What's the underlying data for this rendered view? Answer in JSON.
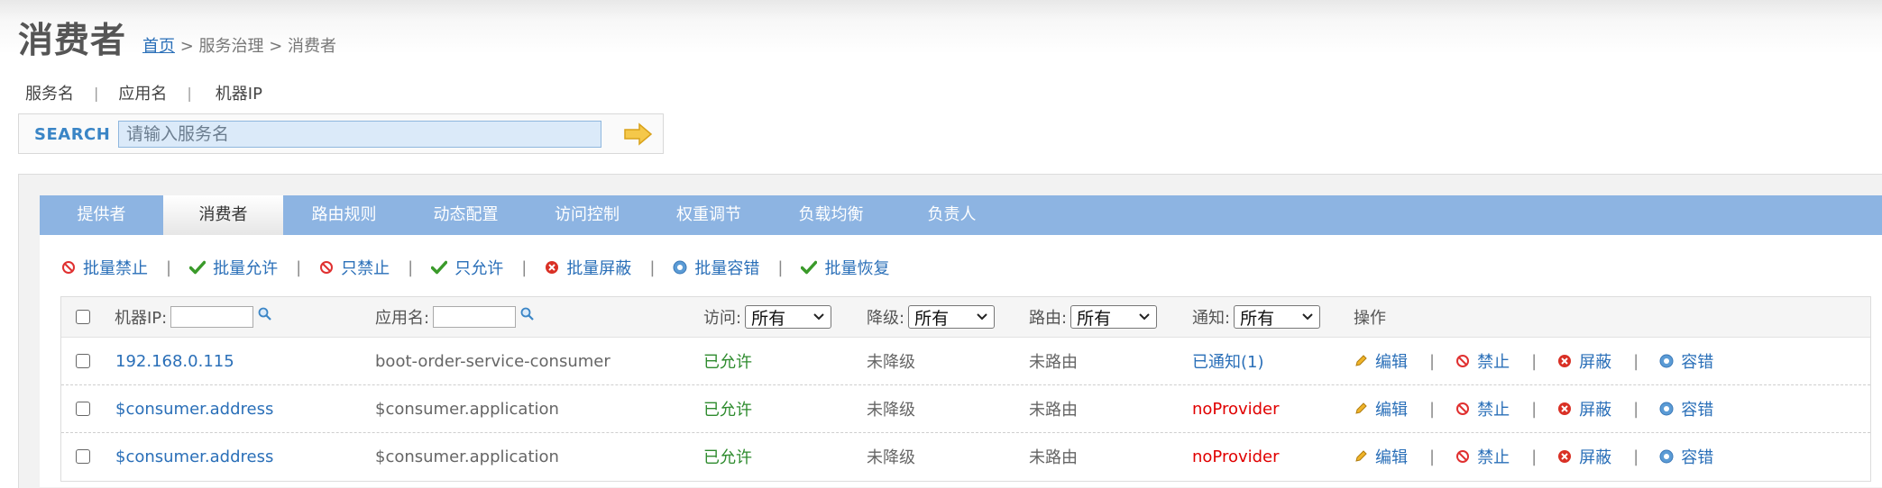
{
  "page": {
    "title": "消费者"
  },
  "breadcrumb": {
    "home": "首页",
    "rest": " > 服务治理 > 消费者"
  },
  "search_tabs": [
    {
      "label": "服务名",
      "active": true
    },
    {
      "label": "应用名",
      "active": false
    },
    {
      "label": "机器IP",
      "active": false
    }
  ],
  "search": {
    "label": "SEARCH",
    "placeholder": "请输入服务名",
    "value": ""
  },
  "tabs": [
    {
      "label": "提供者",
      "active": false
    },
    {
      "label": "消费者",
      "active": true
    },
    {
      "label": "路由规则",
      "active": false
    },
    {
      "label": "动态配置",
      "active": false
    },
    {
      "label": "访问控制",
      "active": false
    },
    {
      "label": "权重调节",
      "active": false
    },
    {
      "label": "负载均衡",
      "active": false
    },
    {
      "label": "负责人",
      "active": false
    }
  ],
  "batch_actions": [
    {
      "label": "批量禁止",
      "icon": "forbid-icon"
    },
    {
      "label": "批量允许",
      "icon": "check-icon"
    },
    {
      "label": "只禁止",
      "icon": "forbid-icon"
    },
    {
      "label": "只允许",
      "icon": "check-icon"
    },
    {
      "label": "批量屏蔽",
      "icon": "shield-x-icon"
    },
    {
      "label": "批量容错",
      "icon": "gear-icon"
    },
    {
      "label": "批量恢复",
      "icon": "check-icon"
    }
  ],
  "table": {
    "headers": {
      "ip": "机器IP:",
      "app": "应用名:",
      "access": "访问:",
      "degrade": "降级:",
      "route": "路由:",
      "notify": "通知:",
      "ops": "操作"
    },
    "filters": {
      "access": "所有",
      "degrade": "所有",
      "route": "所有",
      "notify": "所有"
    },
    "rows": [
      {
        "ip": "192.168.0.115",
        "app": "boot-order-service-consumer",
        "access": "已允许",
        "degrade": "未降级",
        "route": "未路由",
        "notify": "已通知(1)",
        "notify_status": "ok"
      },
      {
        "ip": "$consumer.address",
        "app": "$consumer.application",
        "access": "已允许",
        "degrade": "未降级",
        "route": "未路由",
        "notify": "noProvider",
        "notify_status": "error"
      },
      {
        "ip": "$consumer.address",
        "app": "$consumer.application",
        "access": "已允许",
        "degrade": "未降级",
        "route": "未路由",
        "notify": "noProvider",
        "notify_status": "error"
      }
    ],
    "row_ops": [
      "编辑",
      "禁止",
      "屏蔽",
      "容错"
    ]
  },
  "colors": {
    "accent": "#2a6fb8",
    "tabbar": "#8db4e2",
    "allowed": "#2e8b2e",
    "error": "#e00000"
  }
}
